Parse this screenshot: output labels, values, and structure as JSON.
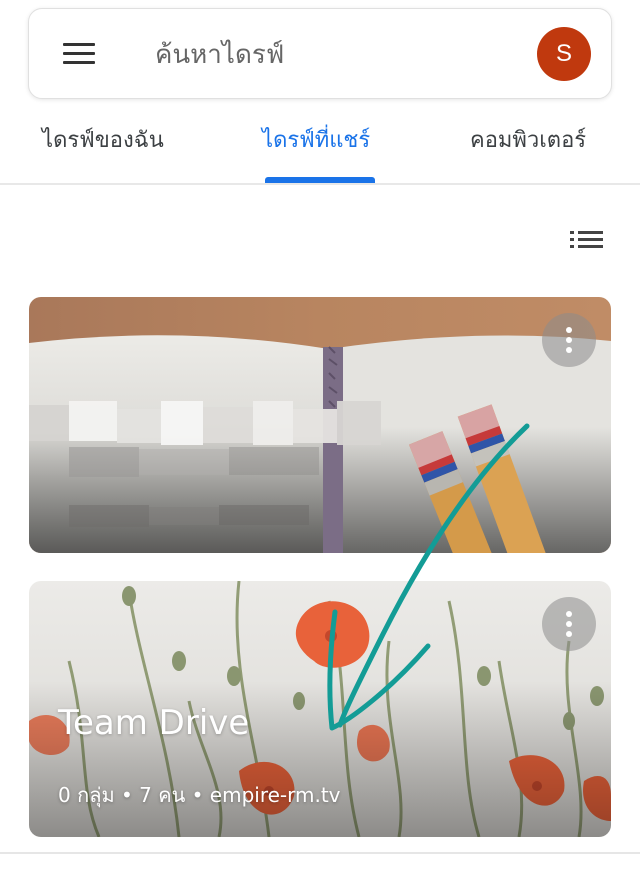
{
  "search": {
    "placeholder": "ค้นหาไดรฟ์"
  },
  "account": {
    "initial": "S",
    "color": "#c0390e"
  },
  "tabs": [
    {
      "label": "ไดรฟ์ของฉัน",
      "active": false
    },
    {
      "label": "ไดรฟ์ที่แชร์",
      "active": true
    },
    {
      "label": "คอมพิวเตอร์",
      "active": false
    }
  ],
  "colors": {
    "accent": "#1a73e8",
    "annotation_arrow": "#139c96"
  },
  "icons": {
    "menu": "menu-icon",
    "list_view": "list-view-icon",
    "more": "more-vert-icon"
  },
  "drives": [
    {
      "title": "",
      "subtitle": "",
      "obscured": true
    },
    {
      "title": "Team Drive",
      "subtitle": "0 กลุ่ม • 7 คน • empire-rm.tv",
      "obscured": false
    }
  ]
}
